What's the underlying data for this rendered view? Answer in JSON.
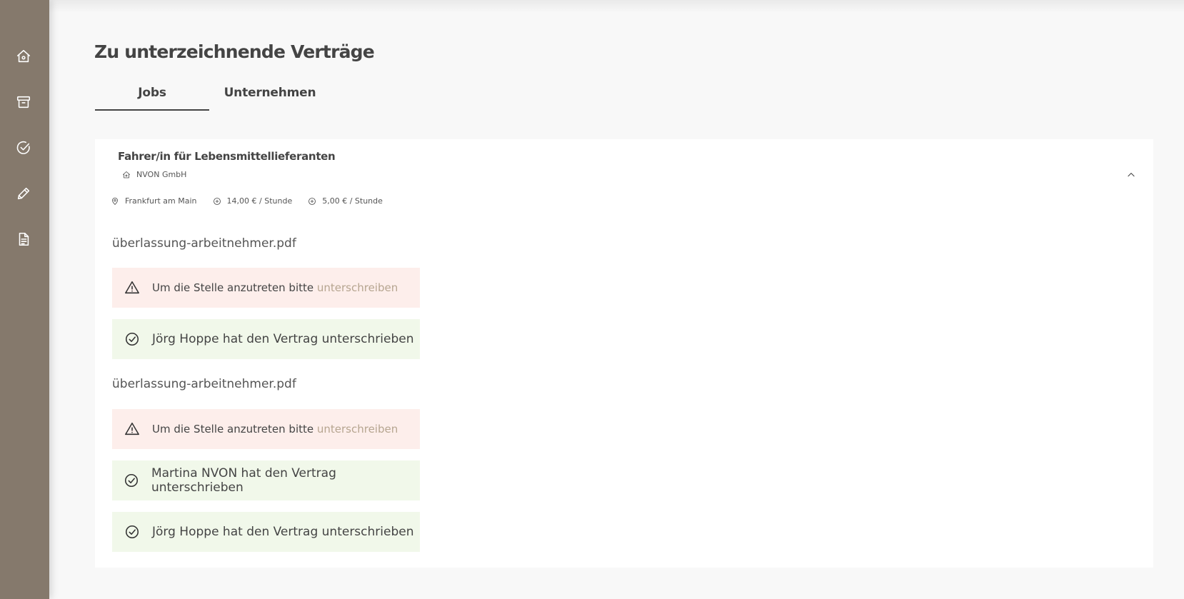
{
  "sidebar": {
    "items": [
      {
        "icon": "home-icon"
      },
      {
        "icon": "archive-icon"
      },
      {
        "icon": "check-circle-icon"
      },
      {
        "icon": "pencil-icon"
      },
      {
        "icon": "document-icon"
      }
    ]
  },
  "page": {
    "title": "Zu unterzeichnende Verträge"
  },
  "tabs": [
    {
      "label": "Jobs",
      "active": true
    },
    {
      "label": "Unternehmen",
      "active": false
    }
  ],
  "job": {
    "title": "Fahrer/in für Lebensmittellieferanten",
    "company": "NVON GmbH",
    "location": "Frankfurt am Main",
    "rate1": "14,00 € / Stunde",
    "rate2": "5,00 € / Stunde"
  },
  "documents": [
    {
      "filename": "überlassung-arbeitnehmer.pdf",
      "warning_text": "Um die Stelle anzutreten bitte ",
      "warning_link": "unterschreiben",
      "signatures": [
        "Jörg Hoppe hat den Vertrag unterschrieben"
      ]
    },
    {
      "filename": "überlassung-arbeitnehmer.pdf",
      "warning_text": "Um die Stelle anzutreten bitte ",
      "warning_link": "unterschreiben",
      "signatures": [
        "Martina NVON hat den Vertrag unterschrieben",
        "Jörg Hoppe hat den Vertrag unterschrieben"
      ]
    }
  ],
  "colors": {
    "sidebar": "#85796c",
    "warning_bg": "#fdeeeb",
    "success_bg": "#f1f8ea",
    "link": "#b6a590"
  }
}
